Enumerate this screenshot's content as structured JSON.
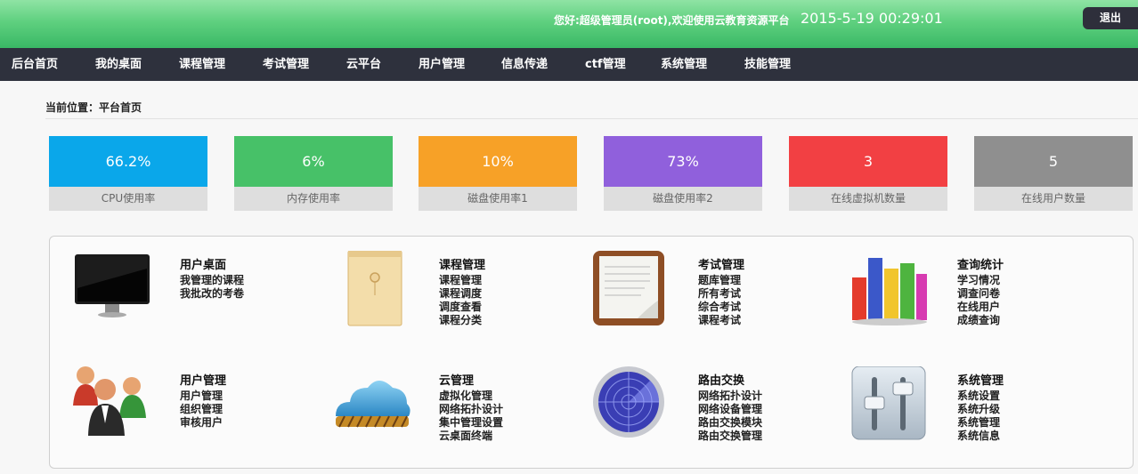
{
  "header": {
    "greeting": "您好:超级管理员(root),欢迎使用云教育资源平台",
    "datetime": "2015-5-19 00:29:01",
    "logout_label": "退出"
  },
  "nav": {
    "items": [
      "后台首页",
      "我的桌面",
      "课程管理",
      "考试管理",
      "云平台",
      "用户管理",
      "信息传递",
      "ctf管理",
      "系统管理",
      "技能管理"
    ]
  },
  "breadcrumb": "当前位置：平台首页",
  "stats": [
    {
      "value": "66.2%",
      "label": "CPU使用率",
      "color": "#0aa7ea"
    },
    {
      "value": "6%",
      "label": "内存使用率",
      "color": "#47c168"
    },
    {
      "value": "10%",
      "label": "磁盘使用率1",
      "color": "#f7a127"
    },
    {
      "value": "73%",
      "label": "磁盘使用率2",
      "color": "#9060dc"
    },
    {
      "value": "3",
      "label": "在线虚拟机数量",
      "color": "#f24043"
    },
    {
      "value": "5",
      "label": "在线用户数量",
      "color": "#8f8f8f"
    }
  ],
  "modules": [
    {
      "title": "用户桌面",
      "icon": "monitor-icon",
      "links": [
        "我管理的课程",
        "我批改的考卷"
      ]
    },
    {
      "title": "课程管理",
      "icon": "folder-icon",
      "links": [
        "课程管理",
        "课程调度",
        "调度查看",
        "课程分类"
      ]
    },
    {
      "title": "考试管理",
      "icon": "notepad-icon",
      "links": [
        "题库管理",
        "所有考试",
        "综合考试",
        "课程考试"
      ]
    },
    {
      "title": "查询统计",
      "icon": "bar-chart-icon",
      "links": [
        "学习情况",
        "调查问卷",
        "在线用户",
        "成绩查询"
      ]
    },
    {
      "title": "用户管理",
      "icon": "users-icon",
      "links": [
        "用户管理",
        "组织管理",
        "审核用户"
      ]
    },
    {
      "title": "云管理",
      "icon": "cloud-icon",
      "links": [
        "虚拟化管理",
        "网络拓扑设计",
        "集中管理设置",
        "云桌面终端"
      ]
    },
    {
      "title": "路由交换",
      "icon": "radar-icon",
      "links": [
        "网络拓扑设计",
        "网络设备管理",
        "路由交换模块",
        "路由交换管理"
      ]
    },
    {
      "title": "系统管理",
      "icon": "sliders-icon",
      "links": [
        "系统设置",
        "系统升级",
        "系统管理",
        "系统信息"
      ]
    }
  ]
}
